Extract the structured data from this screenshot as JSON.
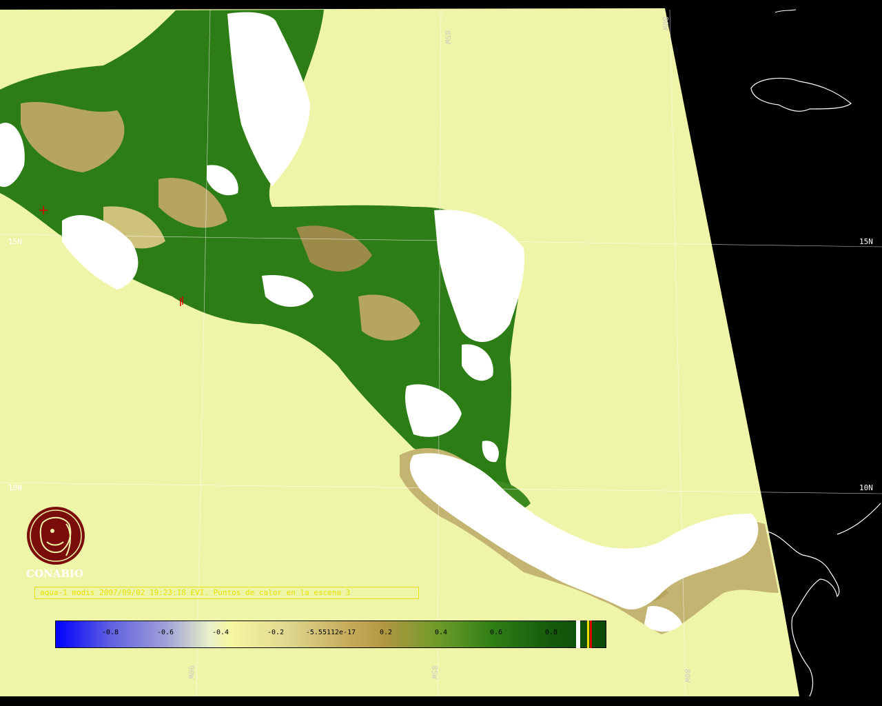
{
  "map": {
    "grid_labels": {
      "lat_15n_left": "15N",
      "lat_15n_right": "15N",
      "lat_10n_left": "10N",
      "lat_10n_right": "10N",
      "lon_85w_top": "85W",
      "lon_80w_top": "80W",
      "lon_90w_bottom": "90W",
      "lon_85w_bottom": "85W",
      "lon_80w_bottom": "80W"
    },
    "colors": {
      "ocean": "#eef5a8",
      "background": "#000000",
      "cloud": "#ffffff",
      "vegetation_dark": "#2d7d16",
      "vegetation_light": "#b5a55e",
      "fire_mark": "#e00000"
    }
  },
  "logo": {
    "name": "CONABIO",
    "color": "#7a0c0c"
  },
  "caption": {
    "text": "aqua-1 modis 2007/09/02 19:23:18 EVI. Puntos de calor en la escena 3"
  },
  "colorbar": {
    "ticks": [
      "-0.8",
      "-0.6",
      "-0.4",
      "-0.2",
      "-5.55112e-17",
      "0.2",
      "0.4",
      "0.6",
      "0.8"
    ]
  }
}
